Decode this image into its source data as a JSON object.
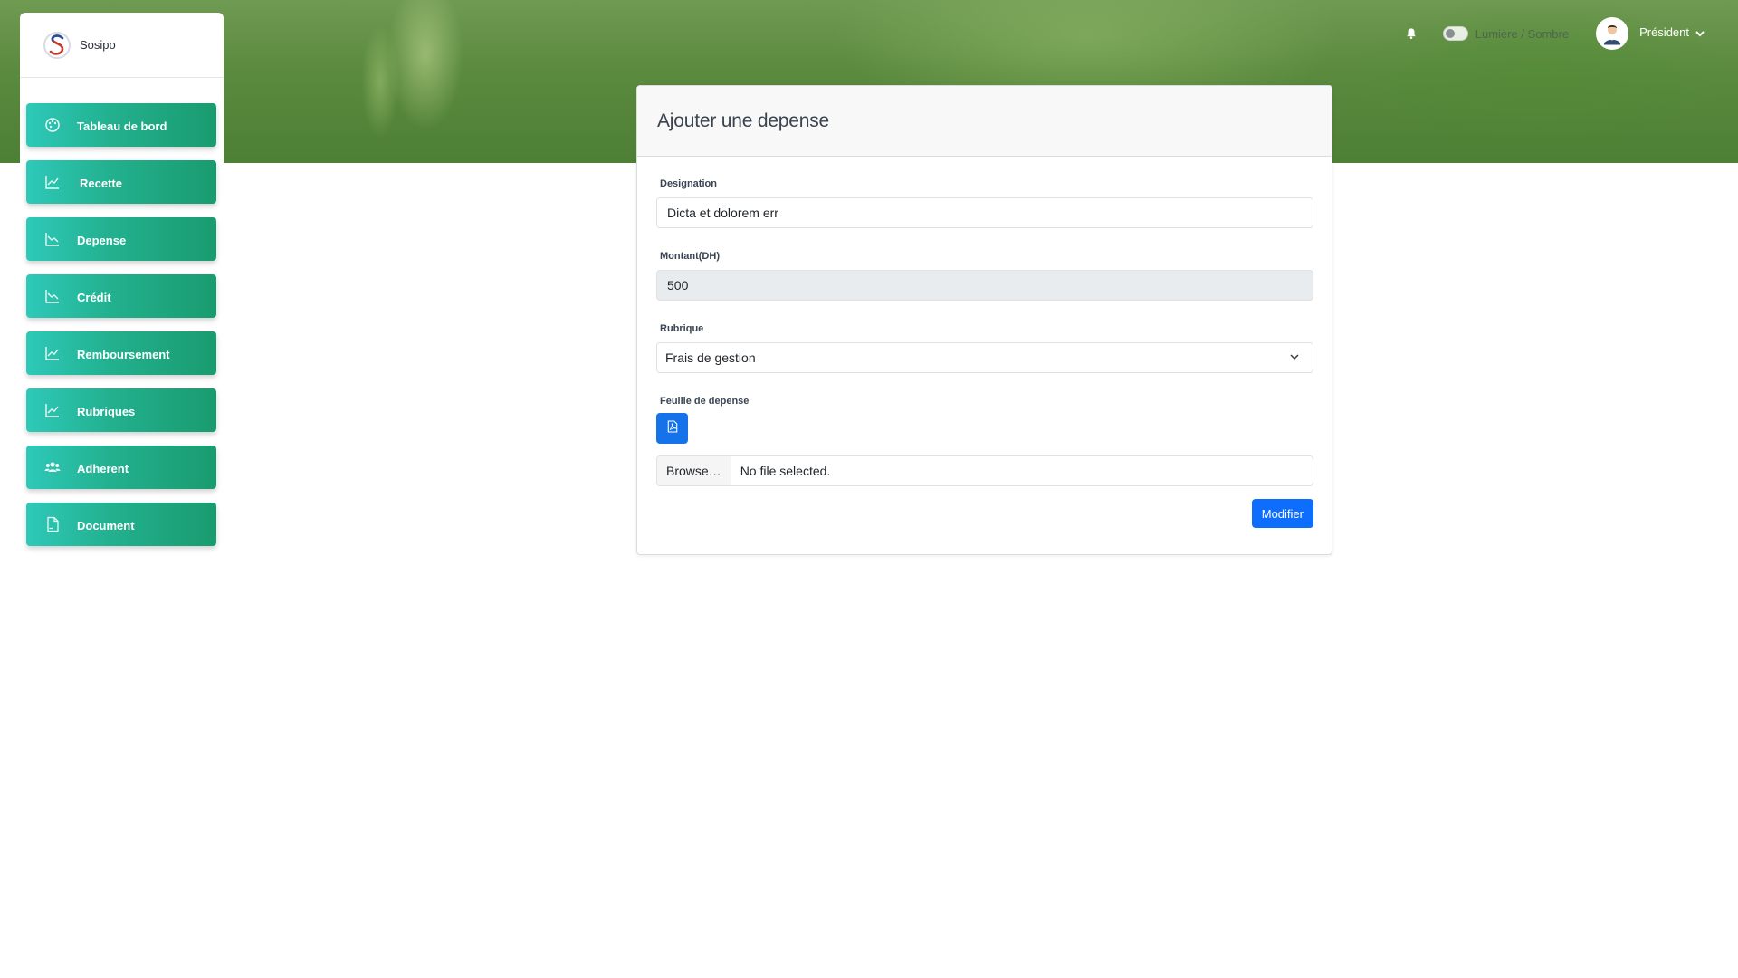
{
  "brand": {
    "name": "Sosipo"
  },
  "sidebar": {
    "items": [
      {
        "label": "Tableau de bord",
        "icon": "palette-icon"
      },
      {
        "label": "Recette",
        "icon": "chart-line-up-icon"
      },
      {
        "label": "Depense",
        "icon": "chart-line-down-icon"
      },
      {
        "label": "Crédit",
        "icon": "chart-line-down-icon"
      },
      {
        "label": "Remboursement",
        "icon": "chart-line-up-icon"
      },
      {
        "label": "Rubriques",
        "icon": "chart-line-up-icon"
      },
      {
        "label": "Adherent",
        "icon": "users-icon"
      },
      {
        "label": "Document",
        "icon": "document-icon"
      }
    ]
  },
  "topbar": {
    "theme_label": "Lumière / Sombre",
    "user_name": "Président"
  },
  "form": {
    "title": "Ajouter une depense",
    "designation": {
      "label": "Designation",
      "value": "Dicta et dolorem err"
    },
    "montant": {
      "label": "Montant(DH)",
      "value": "500"
    },
    "rubrique": {
      "label": "Rubrique",
      "value": "Frais de gestion"
    },
    "feuille": {
      "label": "Feuille de depense"
    },
    "file": {
      "browse_label": "Browse…",
      "status": "No file selected."
    },
    "submit_label": "Modifier"
  },
  "colors": {
    "nav_gradient_start": "#2ec9b9",
    "nav_gradient_end": "#1a9b6f",
    "primary": "#0d6efd"
  }
}
